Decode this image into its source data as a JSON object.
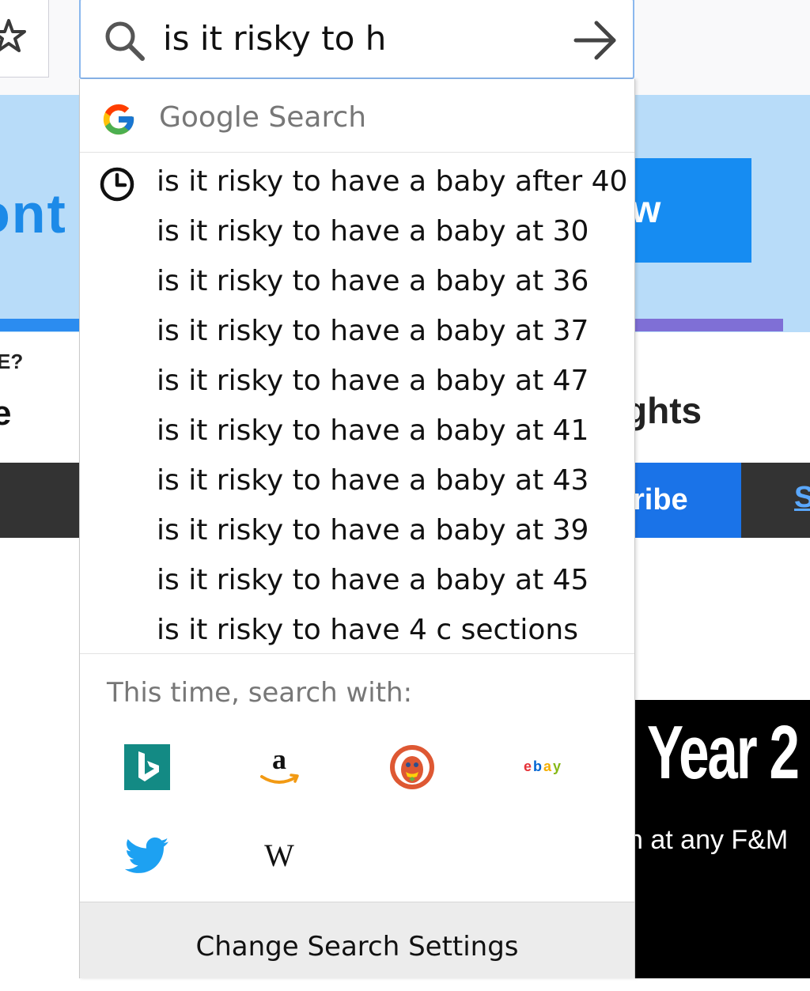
{
  "browser": {
    "bookmark_star_icon": "star-icon"
  },
  "background_page": {
    "banner_text": "ont",
    "cta_text": "w",
    "small_question_text": "E?",
    "small_text": "e",
    "heading_fragment": "ghts",
    "subscribe_fragment": "ribe",
    "link_fragment": "S",
    "ad_title": "Year 2",
    "ad_subtitle": "n at any F&M",
    "colors": {
      "banner": "#b8dcf9",
      "banner_accent": "#1c8ae8",
      "cta": "#168cf2",
      "dark_bar": "#333333",
      "subscribe": "#1a73e8"
    }
  },
  "search": {
    "query": "is it risky to h",
    "search_icon": "search-icon",
    "go_icon": "arrow-right-icon"
  },
  "dropdown": {
    "default_engine": {
      "icon": "google-icon",
      "label": "Google Search"
    },
    "history_icon": "clock-icon",
    "suggestions": [
      "is it risky to have a baby after 40",
      "is it risky to have a baby at 30",
      "is it risky to have a baby at 36",
      "is it risky to have a baby at 37",
      "is it risky to have a baby at 47",
      "is it risky to have a baby at 41",
      "is it risky to have a baby at 43",
      "is it risky to have a baby at 39",
      "is it risky to have a baby at 45",
      "is it risky to have 4 c sections"
    ],
    "alt_engines_label": "This time, search with:",
    "alt_engines": [
      {
        "name": "bing-icon"
      },
      {
        "name": "amazon-icon"
      },
      {
        "name": "duckduckgo-icon"
      },
      {
        "name": "ebay-icon"
      },
      {
        "name": "twitter-icon"
      },
      {
        "name": "wikipedia-icon"
      }
    ],
    "settings_button": "Change Search Settings"
  }
}
